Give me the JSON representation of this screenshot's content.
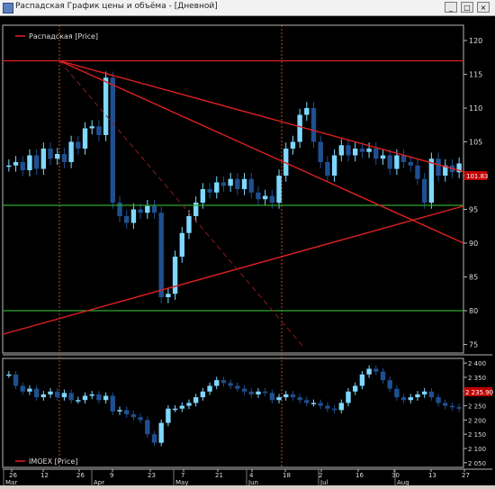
{
  "window": {
    "title": "Распадская График цены и объёма - [Дневной]",
    "buttons": [
      "_",
      "□",
      "×"
    ]
  },
  "top_panel": {
    "legend": "Распадская [Price]",
    "price_tag": "101.83",
    "y_ticks": [
      "120",
      "115",
      "110",
      "105",
      "100",
      "95",
      "90",
      "85",
      "80",
      "75"
    ]
  },
  "bottom_panel": {
    "legend": "IMOEX [Price]",
    "value_tag": "2 235.90",
    "y_ticks": [
      "2 400",
      "2 350",
      "2 300",
      "2 250",
      "2 200",
      "2 150",
      "2 100",
      "2 050"
    ]
  },
  "x_axis": {
    "day_labels": [
      "26",
      "12",
      "26",
      "9",
      "23",
      "7",
      "21",
      "4",
      "18",
      "2",
      "16",
      "30",
      "13",
      "27"
    ],
    "month_labels": [
      "Mar",
      "Apr",
      "May",
      "Jun",
      "Jul",
      "Aug"
    ]
  },
  "colors": {
    "background": "#000000",
    "candle": "#7fd8ff",
    "candle_down": "#1f4f8f",
    "trendline": "#e02020",
    "support_line": "#2ea82e",
    "imoex": "#4fb5e6"
  },
  "chart_data": {
    "type": "candlestick",
    "top": {
      "ylim": [
        74,
        122
      ],
      "close": [
        101.5,
        102.0,
        100.8,
        103.0,
        101.0,
        104.0,
        102.5,
        103.2,
        102.0,
        105.0,
        104.0,
        107.0,
        107.3,
        106.0,
        114.5,
        96.0,
        94.0,
        93.0,
        95.0,
        94.5,
        95.5,
        94.5,
        82.0,
        82.5,
        88.0,
        91.5,
        94.0,
        96.0,
        98.0,
        97.5,
        99.0,
        98.5,
        99.5,
        98.0,
        99.5,
        97.5,
        96.5,
        97.0,
        96.0,
        100.0,
        104.0,
        105.0,
        109.0,
        110.0,
        105.0,
        102.0,
        100.0,
        103.0,
        104.5,
        103.0,
        104.0,
        103.5,
        104.0,
        102.5,
        103.0,
        101.0,
        103.0,
        102.0,
        101.5,
        99.5,
        96.0,
        102.5,
        100.0,
        101.5,
        100.5,
        101.8
      ],
      "horizontal_lines": [
        117.0,
        95.6,
        80.0
      ]
    },
    "bottom": {
      "series": "IMOEX",
      "ylim": [
        2040,
        2410
      ],
      "close": [
        2360,
        2320,
        2300,
        2310,
        2280,
        2290,
        2300,
        2280,
        2295,
        2270,
        2270,
        2285,
        2290,
        2270,
        2285,
        2230,
        2235,
        2220,
        2210,
        2200,
        2150,
        2120,
        2190,
        2240,
        2240,
        2250,
        2260,
        2280,
        2300,
        2320,
        2340,
        2330,
        2320,
        2310,
        2300,
        2290,
        2300,
        2295,
        2270,
        2280,
        2290,
        2280,
        2270,
        2260,
        2260,
        2250,
        2240,
        2235,
        2260,
        2300,
        2320,
        2360,
        2380,
        2370,
        2340,
        2310,
        2280,
        2270,
        2280,
        2290,
        2300,
        2280,
        2260,
        2250,
        2245,
        2240
      ]
    }
  }
}
